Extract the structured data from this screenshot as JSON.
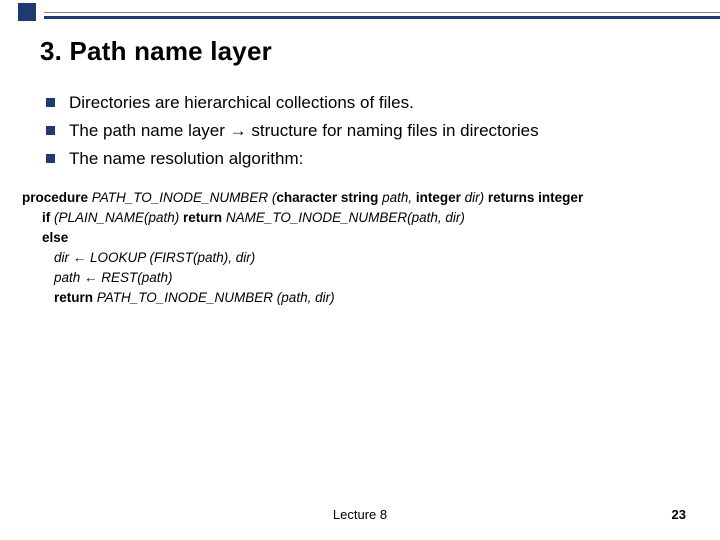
{
  "title": "3. Path name layer",
  "bullets": [
    "Directories are hierarchical collections of files.",
    "The path name layer → structure for naming files in directories",
    "The name resolution algorithm:"
  ],
  "code": {
    "l1": {
      "kw1": "procedure",
      "name": " PATH_TO_INODE_NUMBER (",
      "kw2": "character string",
      "p1": " path, ",
      "kw3": "integer",
      "p2": " dir) ",
      "kw4": "returns integer"
    },
    "l2": {
      "kw": "if",
      "rest": " (PLAIN_NAME(path)  ",
      "kw2": "return",
      "rest2": " NAME_TO_INODE_NUMBER(path, dir)"
    },
    "l3": {
      "kw": "else"
    },
    "l4": "dir ← LOOKUP (FIRST(path), dir)",
    "l5": "path ← REST(path)",
    "l6": {
      "kw": "return",
      "rest": " PATH_TO_INODE_NUMBER (path, dir)"
    }
  },
  "footer": {
    "center": "Lecture 8",
    "page": "23"
  }
}
